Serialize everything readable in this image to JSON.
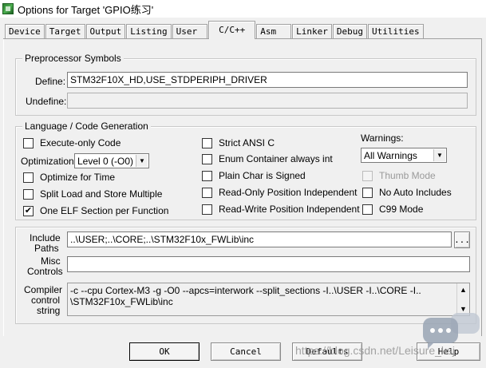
{
  "window": {
    "title": "Options for Target 'GPIO练习'"
  },
  "tabs": [
    "Device",
    "Target",
    "Output",
    "Listing",
    "User",
    "C/C++",
    "Asm",
    "Linker",
    "Debug",
    "Utilities"
  ],
  "preprocessor": {
    "title": "Preprocessor Symbols",
    "define_label": "Define:",
    "define_value": "STM32F10X_HD,USE_STDPERIPH_DRIVER",
    "undefine_label": "Undefine:",
    "undefine_value": ""
  },
  "language": {
    "title": "Language / Code Generation",
    "execute_only": {
      "label": "Execute-only Code",
      "checked": false
    },
    "optimization_label": "Optimization:",
    "optimization_value": "Level 0 (-O0)",
    "optimize_time": {
      "label": "Optimize for Time",
      "checked": false
    },
    "split_load": {
      "label": "Split Load and Store Multiple",
      "checked": false
    },
    "one_elf": {
      "label": "One ELF Section per Function",
      "checked": true
    },
    "strict_ansi": {
      "label": "Strict ANSI C",
      "checked": false
    },
    "enum_container": {
      "label": "Enum Container always int",
      "checked": false
    },
    "plain_char": {
      "label": "Plain Char is Signed",
      "checked": false
    },
    "ro_position": {
      "label": "Read-Only Position Independent",
      "checked": false
    },
    "rw_position": {
      "label": "Read-Write Position Independent",
      "checked": false
    },
    "warnings_label": "Warnings:",
    "warnings_value": "All Warnings",
    "thumb_mode": {
      "label": "Thumb Mode",
      "checked": false,
      "disabled": true
    },
    "no_auto_includes": {
      "label": "No Auto Includes",
      "checked": false
    },
    "c99_mode": {
      "label": "C99 Mode",
      "checked": false
    }
  },
  "paths": {
    "include_label_1": "Include",
    "include_label_2": "Paths",
    "include_value": "..\\USER;..\\CORE;..\\STM32F10x_FWLib\\inc",
    "browse_label": "...",
    "misc_label_1": "Misc",
    "misc_label_2": "Controls",
    "misc_value": "",
    "compiler_label_1": "Compiler",
    "compiler_label_2": "control",
    "compiler_label_3": "string",
    "compiler_line_1": "-c --cpu Cortex-M3 -g -O0 --apcs=interwork --split_sections -I..\\USER -I..\\CORE -I..",
    "compiler_line_2": "\\STM32F10x_FWLib\\inc"
  },
  "buttons": {
    "ok": "OK",
    "cancel": "Cancel",
    "defaults": "Defaults",
    "help": "Help"
  },
  "watermark": "https://blog.csdn.net/Leisure_ksj",
  "icons": {
    "app": "keil-app-icon",
    "chat": "chat-bubble-icon"
  }
}
